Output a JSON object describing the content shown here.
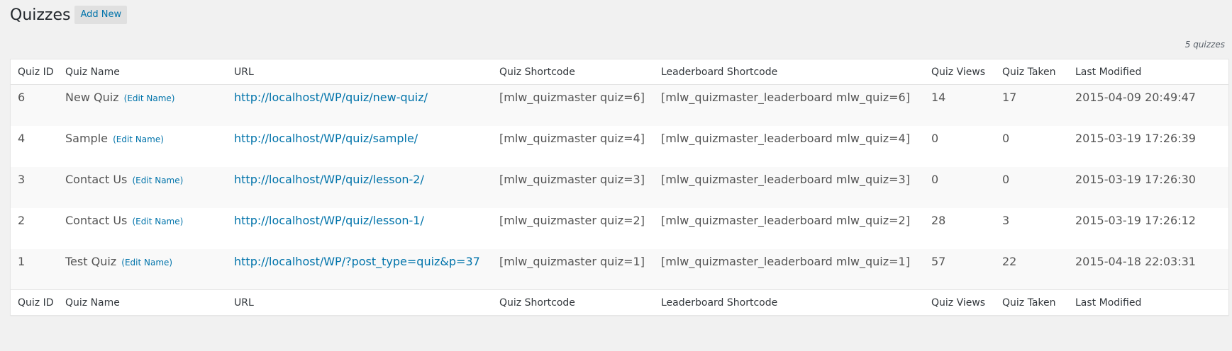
{
  "header": {
    "title": "Quizzes",
    "add_new_label": "Add New"
  },
  "count_text": "5 quizzes",
  "columns": [
    "Quiz ID",
    "Quiz Name",
    "URL",
    "Quiz Shortcode",
    "Leaderboard Shortcode",
    "Quiz Views",
    "Quiz Taken",
    "Last Modified"
  ],
  "edit_name_label": "(Edit Name)",
  "rows": [
    {
      "id": "6",
      "name": "New Quiz",
      "url": "http://localhost/WP/quiz/new-quiz/",
      "shortcode": "[mlw_quizmaster quiz=6]",
      "leaderboard": "[mlw_quizmaster_leaderboard mlw_quiz=6]",
      "views": "14",
      "taken": "17",
      "modified": "2015-04-09 20:49:47"
    },
    {
      "id": "4",
      "name": "Sample",
      "url": "http://localhost/WP/quiz/sample/",
      "shortcode": "[mlw_quizmaster quiz=4]",
      "leaderboard": "[mlw_quizmaster_leaderboard mlw_quiz=4]",
      "views": "0",
      "taken": "0",
      "modified": "2015-03-19 17:26:39"
    },
    {
      "id": "3",
      "name": "Contact Us",
      "url": "http://localhost/WP/quiz/lesson-2/",
      "shortcode": "[mlw_quizmaster quiz=3]",
      "leaderboard": "[mlw_quizmaster_leaderboard mlw_quiz=3]",
      "views": "0",
      "taken": "0",
      "modified": "2015-03-19 17:26:30"
    },
    {
      "id": "2",
      "name": "Contact Us",
      "url": "http://localhost/WP/quiz/lesson-1/",
      "shortcode": "[mlw_quizmaster quiz=2]",
      "leaderboard": "[mlw_quizmaster_leaderboard mlw_quiz=2]",
      "views": "28",
      "taken": "3",
      "modified": "2015-03-19 17:26:12"
    },
    {
      "id": "1",
      "name": "Test Quiz",
      "url": "http://localhost/WP/?post_type=quiz&p=37",
      "shortcode": "[mlw_quizmaster quiz=1]",
      "leaderboard": "[mlw_quizmaster_leaderboard mlw_quiz=1]",
      "views": "57",
      "taken": "22",
      "modified": "2015-04-18 22:03:31"
    }
  ],
  "colors": {
    "link": "#0073aa",
    "background": "#f1f1f1",
    "table_bg": "#ffffff",
    "stripe": "#f9f9f9"
  }
}
